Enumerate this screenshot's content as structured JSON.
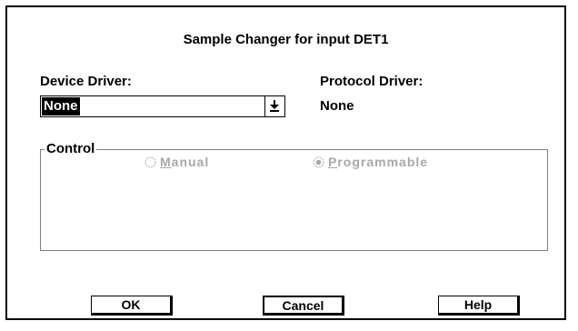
{
  "dialog": {
    "title": "Sample Changer for input DET1",
    "device_driver": {
      "label": "Device Driver:",
      "value": "None"
    },
    "protocol_driver": {
      "label": "Protocol Driver:",
      "value": "None"
    },
    "control": {
      "label": "Control",
      "options": [
        {
          "label_first": "M",
          "label_rest": "anual",
          "selected": false,
          "enabled": false
        },
        {
          "label_first": "P",
          "label_rest": "rogrammable",
          "selected": true,
          "enabled": false
        }
      ]
    },
    "buttons": {
      "ok": "OK",
      "cancel": "Cancel",
      "help": "Help"
    }
  },
  "colors": {
    "disabled_text": "#a8a8a8",
    "selection": "#000000"
  }
}
